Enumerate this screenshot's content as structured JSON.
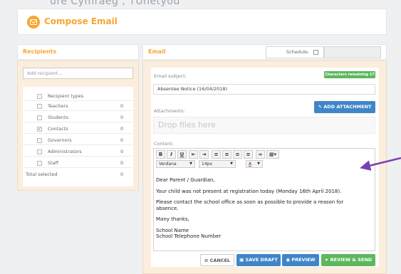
{
  "header": {
    "title": "Compose Email",
    "ghost_text": "ure Cymraeg , TUnetyou"
  },
  "recipients": {
    "heading": "Recipients",
    "add_placeholder": "Add recipient...",
    "types_header": "Recipient types",
    "types": [
      {
        "label": "Teachers",
        "count": "0",
        "checked": false
      },
      {
        "label": "Students",
        "count": "0",
        "checked": false
      },
      {
        "label": "Contacts",
        "count": "0",
        "checked": true
      },
      {
        "label": "Governors",
        "count": "0",
        "checked": false
      },
      {
        "label": "Administrators",
        "count": "0",
        "checked": false
      },
      {
        "label": "Staff",
        "count": "0",
        "checked": false
      }
    ],
    "total_label": "Total selected",
    "total_count": "0"
  },
  "email": {
    "heading": "Email",
    "schedule_label": "Schedule:",
    "subject_label": "Email subject:",
    "chars_badge": "Characters remaining 17",
    "subject_value": "Absentee Notice (16/04/2018)",
    "attachments_label": "Attachments:",
    "add_attachment": "ADD ATTACHMENT",
    "drop_text": "Drop files here",
    "content_label": "Content:",
    "font_family": "Verdana",
    "font_size": "14px",
    "body_lines": [
      "Dear Parent / Guardian,",
      "",
      "Your child was not present at registration today (Monday 16th April 2018).",
      "",
      "Please contact the school office as soon as possible to provide a reason for",
      "absence.",
      "",
      "Many thanks,",
      "",
      "School Name",
      "School Telephone Number"
    ]
  },
  "actions": {
    "cancel": "CANCEL",
    "save_draft": "SAVE DRAFT",
    "preview": "PREVIEW",
    "review_send": "REVIEW & SEND"
  },
  "colors": {
    "accent": "#f7a531",
    "primary": "#3f86c8",
    "success": "#5cb85c",
    "arrow": "#7b3fb0"
  }
}
